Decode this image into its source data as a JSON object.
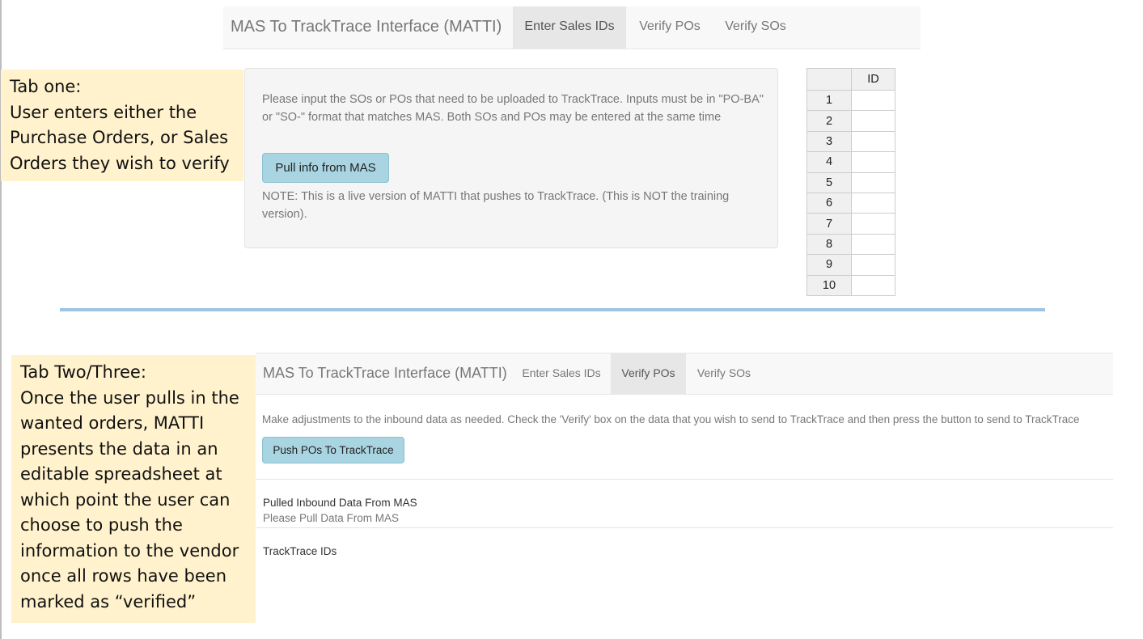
{
  "top": {
    "app_title": "MAS To TrackTrace Interface (MATTI)",
    "tabs": [
      {
        "label": "Enter Sales IDs",
        "active": true
      },
      {
        "label": "Verify POs",
        "active": false
      },
      {
        "label": "Verify SOs",
        "active": false
      }
    ],
    "annotation": [
      "Tab one:",
      "User enters either the",
      "Purchase Orders, or Sales",
      "Orders they wish to verify"
    ],
    "instructions": "Please input the SOs or POs that need to be uploaded to TrackTrace. Inputs must be in \"PO-BA\" or \"SO-\" format that matches MAS. Both SOs and POs may be entered at the same time",
    "pull_button_label": "Pull info from MAS",
    "note": "NOTE: This is a live version of MATTI that pushes to TrackTrace. (This is NOT the training version).",
    "id_grid": {
      "column_header": "ID",
      "row_numbers": [
        "1",
        "2",
        "3",
        "4",
        "5",
        "6",
        "7",
        "8",
        "9",
        "10"
      ]
    }
  },
  "bottom": {
    "app_title": "MAS To TrackTrace Interface (MATTI)",
    "tabs": [
      {
        "label": "Enter Sales IDs",
        "active": false
      },
      {
        "label": "Verify POs",
        "active": true
      },
      {
        "label": "Verify SOs",
        "active": false
      }
    ],
    "annotation": [
      "Tab Two/Three:",
      "Once the user pulls in the",
      "wanted orders, MATTI",
      "presents the data in an",
      "editable spreadsheet at",
      "which point the user can",
      "choose to push the",
      "information to the vendor",
      "once all rows have been",
      "marked as “verified”"
    ],
    "instructions": "Make adjustments to the inbound data as needed. Check the 'Verify' box on the data that you wish to send to TrackTrace and then press the button to send to TrackTrace",
    "push_button_label": "Push POs To TrackTrace",
    "pulled_section_title": "Pulled Inbound Data From MAS",
    "pulled_section_placeholder": "Please Pull Data From MAS",
    "ids_section_title": "TrackTrace IDs"
  },
  "colors": {
    "annotation_bg": "#fff2cc",
    "navbar_bg": "#f8f8f8",
    "active_tab_bg": "#e7e7e7",
    "info_button_bg": "#a9d4e1",
    "divider": "#9dc3e6"
  }
}
